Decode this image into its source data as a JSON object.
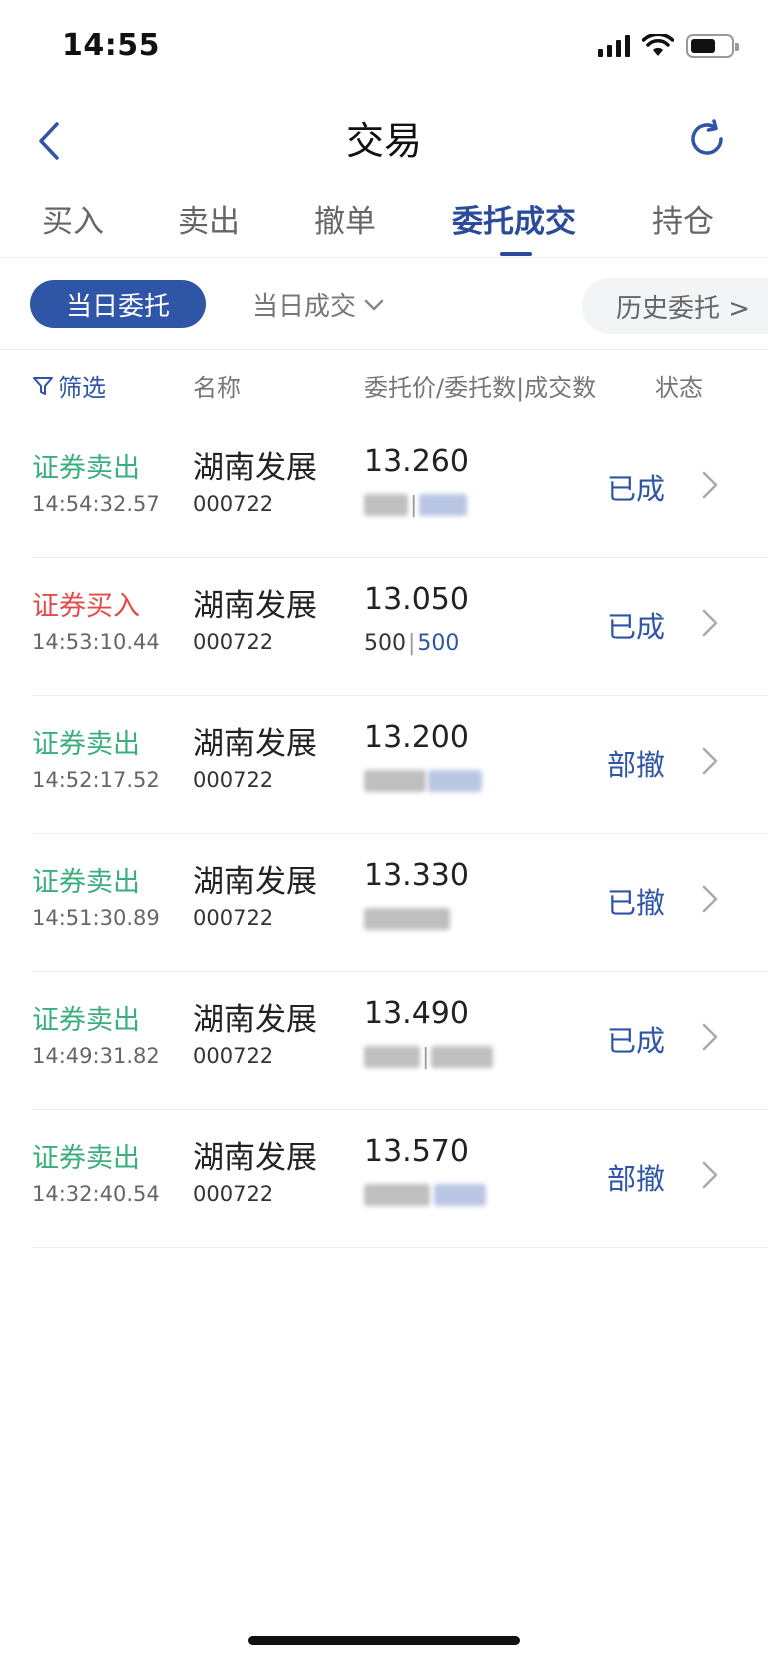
{
  "status_bar": {
    "time": "14:55"
  },
  "header": {
    "title": "交易",
    "back_icon": "chevron-left-icon",
    "refresh_icon": "refresh-icon"
  },
  "tabs": [
    {
      "label": "买入",
      "active": false
    },
    {
      "label": "卖出",
      "active": false
    },
    {
      "label": "撤单",
      "active": false
    },
    {
      "label": "委托成交",
      "active": true
    },
    {
      "label": "持仓",
      "active": false
    }
  ],
  "subtabs": {
    "today_orders": "当日委托",
    "today_deals": "当日成交",
    "history_orders": "历史委托 >"
  },
  "columns": {
    "filter": "筛选",
    "name": "名称",
    "price_qty": "委托价/委托数|成交数",
    "status": "状态"
  },
  "orders": [
    {
      "type": "证券卖出",
      "side": "sell",
      "time": "14:54:32.57",
      "name": "湖南发展",
      "code": "000722",
      "price": "13.260",
      "status": "已成"
    },
    {
      "type": "证券买入",
      "side": "buy",
      "time": "14:53:10.44",
      "name": "湖南发展",
      "code": "000722",
      "price": "13.050",
      "order_qty": "500",
      "filled_qty": "500",
      "status": "已成"
    },
    {
      "type": "证券卖出",
      "side": "sell",
      "time": "14:52:17.52",
      "name": "湖南发展",
      "code": "000722",
      "price": "13.200",
      "status": "部撤"
    },
    {
      "type": "证券卖出",
      "side": "sell",
      "time": "14:51:30.89",
      "name": "湖南发展",
      "code": "000722",
      "price": "13.330",
      "status": "已撤"
    },
    {
      "type": "证券卖出",
      "side": "sell",
      "time": "14:49:31.82",
      "name": "湖南发展",
      "code": "000722",
      "price": "13.490",
      "status": "已成"
    },
    {
      "type": "证券卖出",
      "side": "sell",
      "time": "14:32:40.54",
      "name": "湖南发展",
      "code": "000722",
      "price": "13.570",
      "status": "部撤"
    }
  ],
  "colors": {
    "accent": "#2f56a6",
    "sell": "#3aae7c",
    "buy": "#e34b4b"
  }
}
